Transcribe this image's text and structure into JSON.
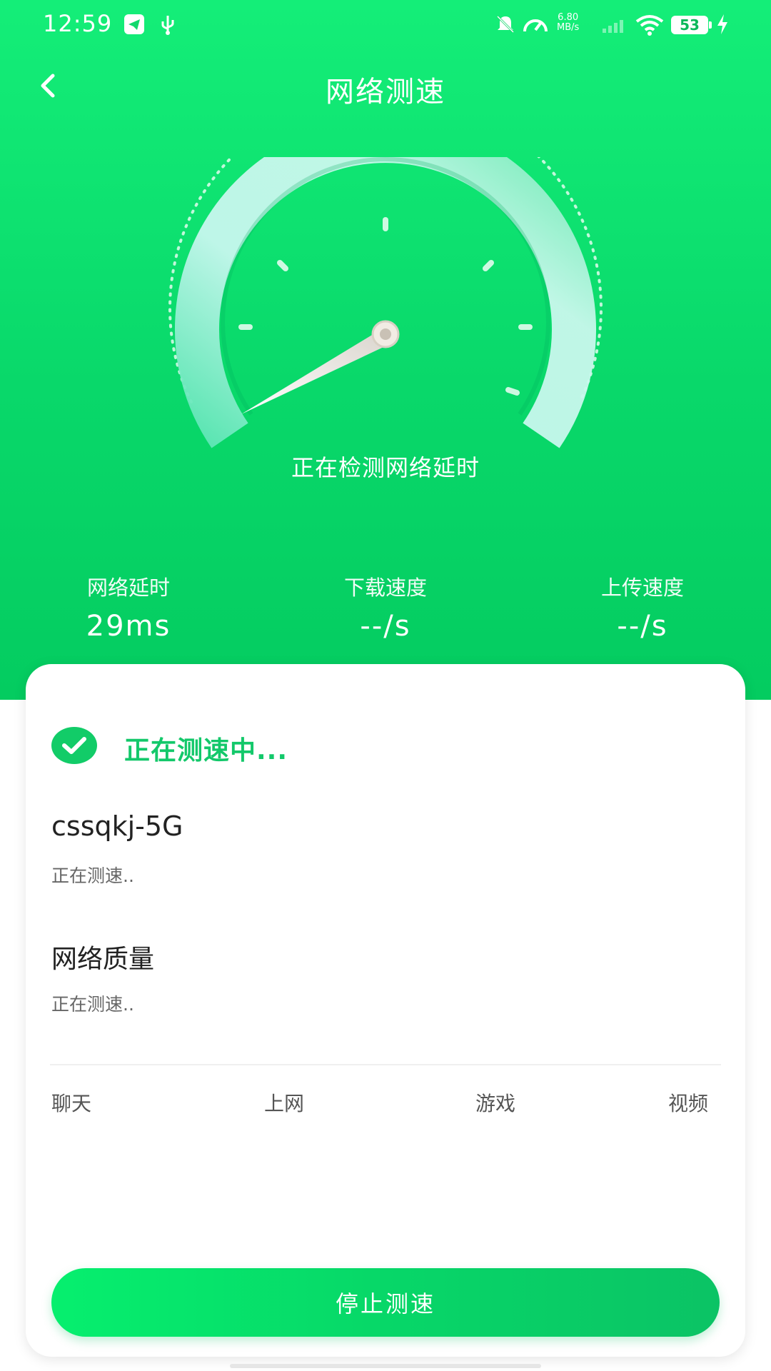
{
  "status_bar": {
    "time": "12:59",
    "net_speed_value": "6.80",
    "net_speed_unit": "MB/s",
    "battery": "53"
  },
  "header": {
    "title": "网络测速"
  },
  "gauge": {
    "status_text": "正在检测网络延时"
  },
  "stats": [
    {
      "label": "网络延时",
      "value": "29ms"
    },
    {
      "label": "下载速度",
      "value": "--/s"
    },
    {
      "label": "上传速度",
      "value": "--/s"
    }
  ],
  "card": {
    "progress_title": "正在测速中...",
    "ssid": "cssqkj-5G",
    "ssid_status": "正在测速..",
    "quality_title": "网络质量",
    "quality_status": "正在测速..",
    "categories": [
      "聊天",
      "上网",
      "游戏",
      "视频"
    ],
    "stop_button": "停止测速"
  },
  "colors": {
    "primary": "#0bd868",
    "accent_text": "#13c86a"
  }
}
